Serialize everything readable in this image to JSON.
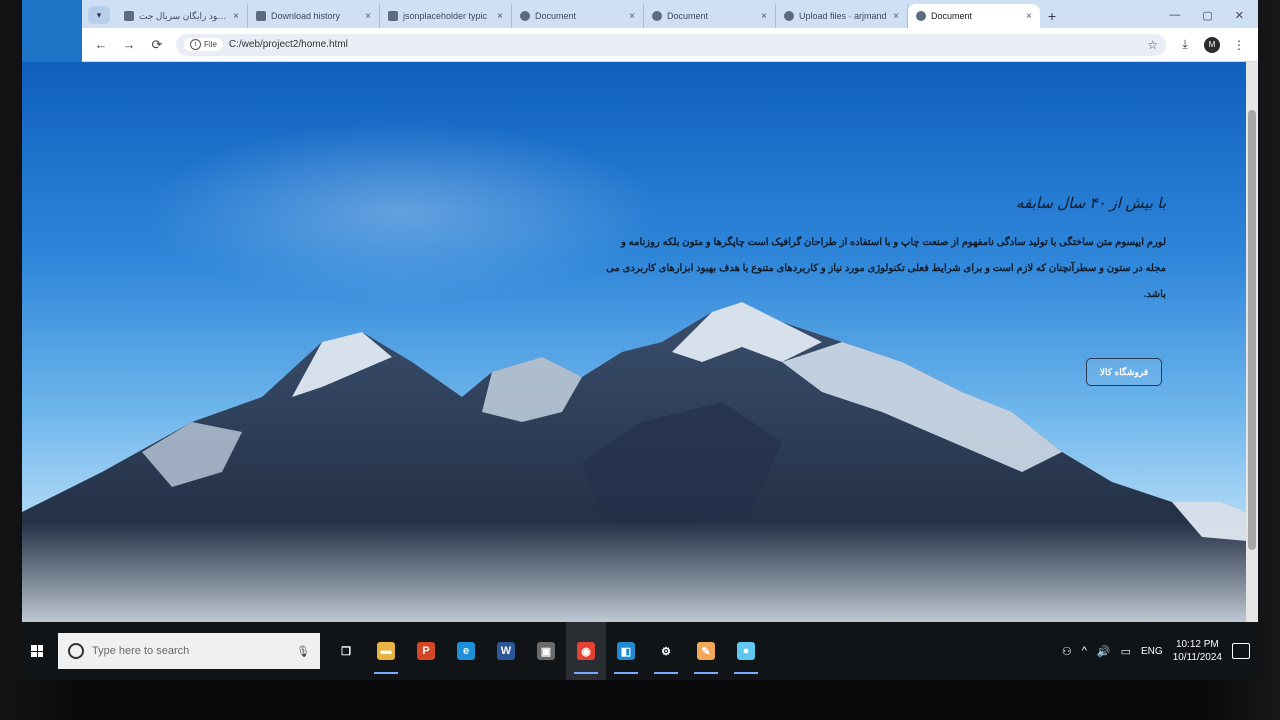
{
  "browser": {
    "tabs": [
      {
        "title": "دانلود رایگان سریال جت",
        "icon": "page-icon",
        "active": false
      },
      {
        "title": "Download history",
        "icon": "download-icon",
        "active": false
      },
      {
        "title": "jsonplaceholder typic",
        "icon": "page-icon",
        "active": false
      },
      {
        "title": "Document",
        "icon": "globe-icon",
        "active": false
      },
      {
        "title": "Document",
        "icon": "globe-icon",
        "active": false
      },
      {
        "title": "Upload files · arjmand",
        "icon": "github-icon",
        "active": false
      },
      {
        "title": "Document",
        "icon": "globe-icon",
        "active": true
      }
    ],
    "close_glyph": "×",
    "new_tab_glyph": "+",
    "window_controls": {
      "minimize": "—",
      "maximize": "▢",
      "close": "✕"
    },
    "toolbar": {
      "back": "←",
      "forward": "→",
      "reload": "⟳",
      "chip_label": "File",
      "url": "C:/web/project2/home.html",
      "bookmark": "☆",
      "download": "⤓",
      "profile_initial": "M",
      "menu": "⋮"
    }
  },
  "page": {
    "heading": "با بیش از ۴۰ سال سابقه",
    "paragraph": "لورم ایپسوم متن ساختگی با تولید سادگی نامفهوم از صنعت چاپ و با استفاده از طراحان گرافیک است چاپگرها و متون بلکه روزنامه و مجله در ستون و سطرآنچنان که لازم است و برای شرایط فعلی تکنولوژی مورد نیاز و کاربردهای متنوع با هدف بهبود ابزارهای کاربردی می باشد.",
    "button_label": "فروشگاه کالا"
  },
  "taskbar": {
    "search_placeholder": "Type here to search",
    "apps": [
      {
        "name": "task-view-icon",
        "glyph": "❐",
        "color": "#111417"
      },
      {
        "name": "file-explorer-icon",
        "glyph": "▬",
        "color": "#e8b341"
      },
      {
        "name": "powerpoint-icon",
        "glyph": "P",
        "color": "#d24726"
      },
      {
        "name": "edge-icon",
        "glyph": "e",
        "color": "#1e8fd8"
      },
      {
        "name": "word-icon",
        "glyph": "W",
        "color": "#2b5797"
      },
      {
        "name": "store-icon",
        "glyph": "▣",
        "color": "#6a6a6a"
      },
      {
        "name": "chrome-icon",
        "glyph": "◉",
        "color": "#e34133"
      },
      {
        "name": "vscode-icon",
        "glyph": "◧",
        "color": "#1f8ad2"
      },
      {
        "name": "settings-icon",
        "glyph": "⚙",
        "color": "#111417"
      },
      {
        "name": "paint-icon",
        "glyph": "✎",
        "color": "#f2a65a"
      },
      {
        "name": "app-icon",
        "glyph": "●",
        "color": "#5ec8f0"
      }
    ],
    "tray": {
      "people": "⚇",
      "chevron": "^",
      "volume": "🔊",
      "battery": "▭",
      "language": "ENG",
      "time": "10:12 PM",
      "date": "10/11/2024"
    }
  }
}
